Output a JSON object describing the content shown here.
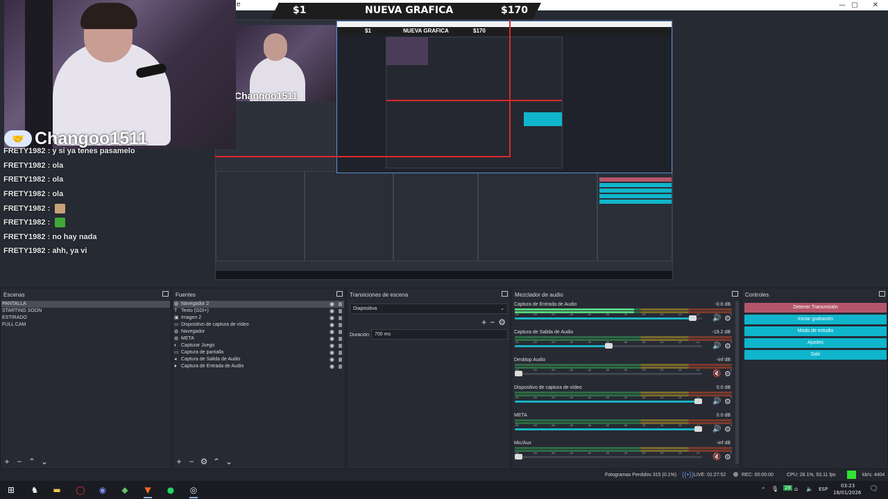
{
  "preview": {
    "banner": {
      "left_amount": "$1",
      "center": "NUEVA GRAFICA",
      "right_amount": "$170"
    },
    "window_controls": {
      "minimize": "—",
      "maximize": "▢",
      "close": "✕"
    },
    "cam_name": "Changoo1511",
    "chat": [
      {
        "user": "FRETY1982",
        "msg": "y si ya tenes pasamelo",
        "emote": ""
      },
      {
        "user": "FRETY1982",
        "msg": "ola",
        "emote": ""
      },
      {
        "user": "FRETY1982",
        "msg": "ola",
        "emote": ""
      },
      {
        "user": "FRETY1982",
        "msg": "ola",
        "emote": ""
      },
      {
        "user": "FRETY1982",
        "msg": "",
        "emote": "face"
      },
      {
        "user": "FRETY1982",
        "msg": "",
        "emote": "green"
      },
      {
        "user": "FRETY1982",
        "msg": "no hay nada",
        "emote": ""
      },
      {
        "user": "FRETY1982",
        "msg": "ahh, ya vi",
        "emote": ""
      }
    ]
  },
  "docks": {
    "scenes": {
      "title": "Escenas",
      "items": [
        "PANTALLA",
        "STARTING SOON",
        "ESTIRADO",
        "FULL CAM"
      ],
      "selected": 0
    },
    "sources": {
      "title": "Fuentes",
      "items": [
        {
          "label": "Navegador 2",
          "icon": "globe-icon"
        },
        {
          "label": "Texto (GDI+)",
          "icon": "text-icon"
        },
        {
          "label": "Imagen 2",
          "icon": "image-icon"
        },
        {
          "label": "Dispositivo de captura de vídeo",
          "icon": "camera-icon"
        },
        {
          "label": "Navegador",
          "icon": "globe-icon"
        },
        {
          "label": "META",
          "icon": "globe-icon"
        },
        {
          "label": "Capturar Juego",
          "icon": "gamepad-icon"
        },
        {
          "label": "Captura de pantalla",
          "icon": "monitor-icon"
        },
        {
          "label": "Captura de Salida de Audio",
          "icon": "speaker-icon"
        },
        {
          "label": "Captura de Entrada de Audio",
          "icon": "mic-icon"
        }
      ],
      "selected": 0
    },
    "transitions": {
      "title": "Transiciones de escena",
      "transition": "Diapositiva",
      "duration_label": "Duración",
      "duration_value": "700 ms"
    },
    "mixer": {
      "title": "Mezclador de audio",
      "ticks": [
        "-60",
        "-55",
        "-50",
        "-45",
        "-40",
        "-35",
        "-30",
        "-25",
        "-20",
        "-15",
        "-10",
        "-5",
        "0"
      ],
      "channels": [
        {
          "name": "Captura de Entrada de Audio",
          "db": "-0.6 dB",
          "level": 0.55,
          "volume": 0.97,
          "muted": false
        },
        {
          "name": "Captura de Salida de Audio",
          "db": "-19.2 dB",
          "level": 0.0,
          "volume": 0.5,
          "muted": false
        },
        {
          "name": "Desktop Audio",
          "db": "-inf dB",
          "level": 0.0,
          "volume": 0.0,
          "muted": true
        },
        {
          "name": "Dispositivo de captura de vídeo",
          "db": "0.0 dB",
          "level": 0.0,
          "volume": 1.0,
          "muted": false
        },
        {
          "name": "META",
          "db": "0.0 dB",
          "level": 0.0,
          "volume": 1.0,
          "muted": false
        },
        {
          "name": "Mic/Aux",
          "db": "-inf dB",
          "level": 0.0,
          "volume": 0.0,
          "muted": true
        }
      ]
    },
    "controls": {
      "title": "Controles",
      "stop_stream": "Detener Transmisión",
      "start_recording": "Iniciar grabación",
      "studio_mode": "Modo de estudio",
      "settings": "Ajustes",
      "exit": "Salir"
    }
  },
  "status": {
    "dropped_frames": "Fotogramas Perdidos 315 (0.1%)",
    "live": "LIVE: 01:27:52",
    "rec": "REC: 00:00:00",
    "cpu": "CPU: 28.1%, 53.11 fps",
    "kbps": "kb/s: 4404"
  },
  "taskbar": {
    "lang": "ESP",
    "time": "03:23",
    "date": "18/01/2026",
    "badge": "28"
  },
  "colors": {
    "stop_button": "#b4566b",
    "accent_button": "#0fb5cc",
    "bg": "#2b2e38",
    "red_line": "#e0272d"
  }
}
